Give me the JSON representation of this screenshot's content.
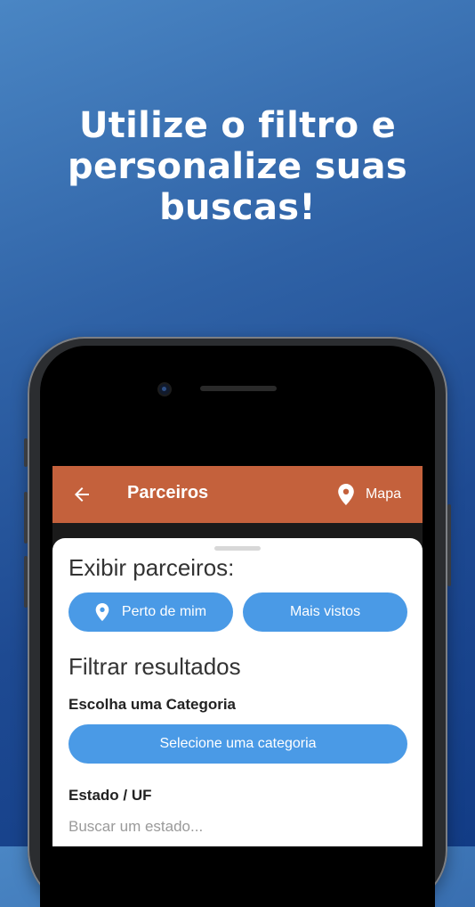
{
  "headline": {
    "line1": "Utilize o filtro e",
    "line2": "personalize suas",
    "line3": "buscas!"
  },
  "appbar": {
    "title": "Parceiros",
    "map_label": "Mapa",
    "color": "#c4613c"
  },
  "filter_sheet": {
    "show_partners_title": "Exibir parceiros:",
    "near_me_button": "Perto de mim",
    "most_viewed_button": "Mais vistos",
    "filter_results_title": "Filtrar resultados",
    "category_label": "Escolha uma Categoria",
    "category_select": "Selecione uma categoria",
    "state_label": "Estado / UF",
    "state_search_placeholder": "Buscar um estado...",
    "accent_color": "#4a9ae6"
  },
  "icons": {
    "back": "arrow-left-icon",
    "map": "map-pin-icon",
    "near_me": "map-pin-icon"
  }
}
